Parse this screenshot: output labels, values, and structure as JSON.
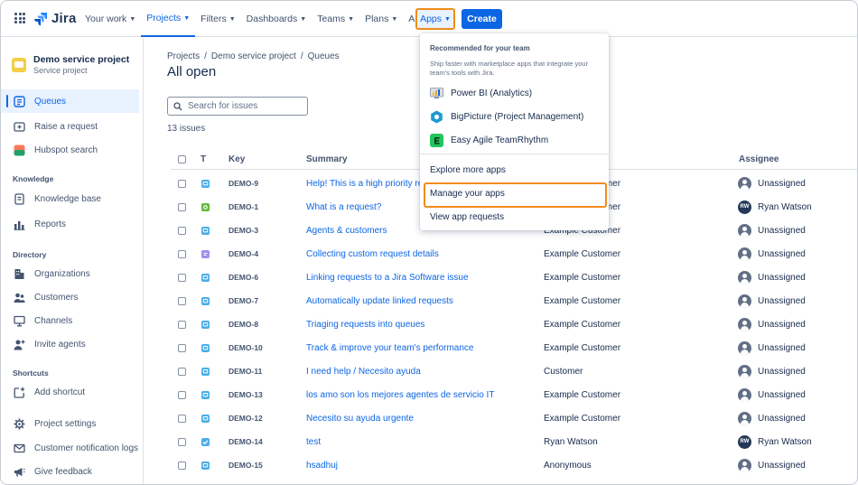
{
  "nav": {
    "logo_text": "Jira",
    "items": [
      {
        "label": "Your work",
        "has_chevron": true
      },
      {
        "label": "Projects",
        "has_chevron": true,
        "active": true
      },
      {
        "label": "Filters",
        "has_chevron": true
      },
      {
        "label": "Dashboards",
        "has_chevron": true
      },
      {
        "label": "Teams",
        "has_chevron": true
      },
      {
        "label": "Plans",
        "has_chevron": true
      },
      {
        "label": "Assets",
        "has_chevron": false
      }
    ],
    "apps_label": "Apps",
    "create_label": "Create"
  },
  "sidebar": {
    "project_name": "Demo service project",
    "project_type": "Service project",
    "items_top": [
      {
        "label": "Queues",
        "icon": "queues-icon",
        "active": true
      },
      {
        "label": "Raise a request",
        "icon": "raise-request-icon"
      },
      {
        "label": "Hubspot search",
        "icon": "hubspot-icon"
      }
    ],
    "knowledge_heading": "Knowledge",
    "items_knowledge": [
      {
        "label": "Knowledge base",
        "icon": "book-icon"
      },
      {
        "label": "Reports",
        "icon": "reports-icon"
      }
    ],
    "directory_heading": "Directory",
    "items_directory": [
      {
        "label": "Organizations",
        "icon": "building-icon"
      },
      {
        "label": "Customers",
        "icon": "people-icon"
      },
      {
        "label": "Channels",
        "icon": "monitor-icon"
      },
      {
        "label": "Invite agents",
        "icon": "invite-icon"
      }
    ],
    "shortcuts_heading": "Shortcuts",
    "items_shortcuts": [
      {
        "label": "Add shortcut",
        "icon": "add-shortcut-icon"
      }
    ],
    "items_bottom": [
      {
        "label": "Project settings",
        "icon": "gear-icon"
      },
      {
        "label": "Customer notification logs",
        "icon": "mail-icon"
      },
      {
        "label": "Give feedback",
        "icon": "megaphone-icon"
      }
    ]
  },
  "main": {
    "breadcrumb": [
      "Projects",
      "Demo service project",
      "Queues"
    ],
    "title": "All open",
    "search_placeholder": "Search for issues",
    "issue_count": "13 issues",
    "columns": {
      "type": "T",
      "key": "Key",
      "summary": "Summary",
      "assignee": "Assignee"
    },
    "rows": [
      {
        "type": "service-request",
        "key": "DEMO-9",
        "summary": "Help! This is a high priority request",
        "reporter": "Example Customer",
        "assignee": "Unassigned",
        "assignee_initials": ""
      },
      {
        "type": "incident",
        "key": "DEMO-1",
        "summary": "What is a request?",
        "reporter": "Example Customer",
        "assignee": "Ryan Watson",
        "assignee_initials": "RW"
      },
      {
        "type": "service-request",
        "key": "DEMO-3",
        "summary": "Agents & customers",
        "reporter": "Example Customer",
        "assignee": "Unassigned",
        "assignee_initials": ""
      },
      {
        "type": "feedback",
        "key": "DEMO-4",
        "summary": "Collecting custom request details",
        "reporter": "Example Customer",
        "assignee": "Unassigned",
        "assignee_initials": ""
      },
      {
        "type": "service-request",
        "key": "DEMO-6",
        "summary": "Linking requests to a Jira Software issue",
        "reporter": "Example Customer",
        "assignee": "Unassigned",
        "assignee_initials": ""
      },
      {
        "type": "service-request",
        "key": "DEMO-7",
        "summary": "Automatically update linked requests",
        "reporter": "Example Customer",
        "assignee": "Unassigned",
        "assignee_initials": ""
      },
      {
        "type": "service-request",
        "key": "DEMO-8",
        "summary": "Triaging requests into queues",
        "reporter": "Example Customer",
        "assignee": "Unassigned",
        "assignee_initials": ""
      },
      {
        "type": "service-request",
        "key": "DEMO-10",
        "summary": "Track & improve your team's performance",
        "reporter": "Example Customer",
        "assignee": "Unassigned",
        "assignee_initials": ""
      },
      {
        "type": "service-request",
        "key": "DEMO-11",
        "summary": "I need help / Necesito ayuda",
        "reporter": "Customer",
        "assignee": "Unassigned",
        "assignee_initials": ""
      },
      {
        "type": "service-request",
        "key": "DEMO-13",
        "summary": "los amo son los mejores agentes de servicio IT",
        "reporter": "Example Customer",
        "assignee": "Unassigned",
        "assignee_initials": ""
      },
      {
        "type": "service-request",
        "key": "DEMO-12",
        "summary": "Necesito su ayuda urgente",
        "reporter": "Example Customer",
        "assignee": "Unassigned",
        "assignee_initials": ""
      },
      {
        "type": "task",
        "key": "DEMO-14",
        "summary": "test",
        "reporter": "Ryan Watson",
        "assignee": "Ryan Watson",
        "assignee_initials": "RW"
      },
      {
        "type": "service-request",
        "key": "DEMO-15",
        "summary": "hsadhuj",
        "reporter": "Anonymous",
        "assignee": "Unassigned",
        "assignee_initials": ""
      }
    ]
  },
  "apps_menu": {
    "heading": "Recommended for your team",
    "description": "Ship faster with marketplace apps that integrate your team's tools with Jira.",
    "apps": [
      {
        "label": "Power BI (Analytics)",
        "icon": "power-bi-icon"
      },
      {
        "label": "BigPicture (Project Management)",
        "icon": "bigpicture-icon"
      },
      {
        "label": "Easy Agile TeamRhythm",
        "icon": "easy-agile-icon"
      }
    ],
    "explore_label": "Explore more apps",
    "manage_label": "Manage your apps",
    "view_requests_label": "View app requests"
  },
  "colors": {
    "accent": "#0C66E4",
    "highlight": "#F08C1C",
    "service_request": "#4BADE8",
    "incident": "#63BA3C",
    "feedback": "#9F8FEF"
  }
}
